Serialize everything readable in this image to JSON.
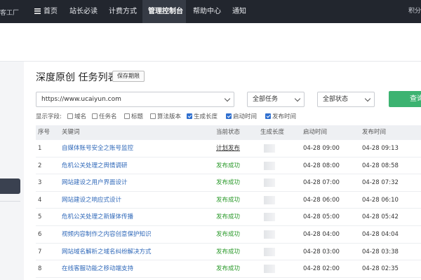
{
  "nav": {
    "brand": "客工厂",
    "items": [
      "首页",
      "站长必读",
      "计费方式",
      "管理控制台",
      "帮助中心",
      "通知"
    ],
    "right": "积分"
  },
  "header": {
    "title": "深度原创 任务列表",
    "save_label": "保存期限"
  },
  "filters": {
    "url": "https://www.ucaiyun.com",
    "task_select": "全部任务",
    "status_select": "全部状态",
    "query_label": "查询"
  },
  "fields": {
    "label": "显示字段:",
    "items": [
      {
        "label": "域名",
        "checked": false
      },
      {
        "label": "任务名",
        "checked": false
      },
      {
        "label": "标题",
        "checked": false
      },
      {
        "label": "算法版本",
        "checked": false
      },
      {
        "label": "生成长度",
        "checked": true
      },
      {
        "label": "启动时间",
        "checked": true
      },
      {
        "label": "发布时间",
        "checked": true
      }
    ]
  },
  "table": {
    "columns": [
      "序号",
      "关键词",
      "当前状态",
      "生成长度",
      "启动时间",
      "发布时间"
    ],
    "rows": [
      {
        "no": "1",
        "keyword": "自媒体账号安全之账号监控",
        "status": "计划发布",
        "start": "04-28 09:00",
        "publish": "04-28 09:13"
      },
      {
        "no": "2",
        "keyword": "危机公关处理之舆情调研",
        "status": "发布成功",
        "start": "04-28 08:00",
        "publish": "04-28 08:58"
      },
      {
        "no": "3",
        "keyword": "网站建设之用户界面设计",
        "status": "发布成功",
        "start": "04-28 07:00",
        "publish": "04-28 07:32"
      },
      {
        "no": "4",
        "keyword": "网站建设之响应式设计",
        "status": "发布成功",
        "start": "04-28 06:00",
        "publish": "04-28 06:10"
      },
      {
        "no": "5",
        "keyword": "危机公关处理之新媒体传播",
        "status": "发布成功",
        "start": "04-28 05:00",
        "publish": "04-28 05:42"
      },
      {
        "no": "6",
        "keyword": "视频内容制作之内容创意保护知识",
        "status": "发布成功",
        "start": "04-28 04:00",
        "publish": "04-28 04:04"
      },
      {
        "no": "7",
        "keyword": "网站域名解析之域名纠纷解决方式",
        "status": "发布成功",
        "start": "04-28 03:00",
        "publish": "04-28 03:38"
      },
      {
        "no": "8",
        "keyword": "在线客服功能之移动端支持",
        "status": "发布成功",
        "start": "04-28 02:00",
        "publish": "04-28 02:35"
      }
    ]
  },
  "colors": {
    "nav_bg": "#22262e",
    "link": "#2f68b9",
    "success": "#2b9a2b",
    "query_button": "#3cb371"
  }
}
